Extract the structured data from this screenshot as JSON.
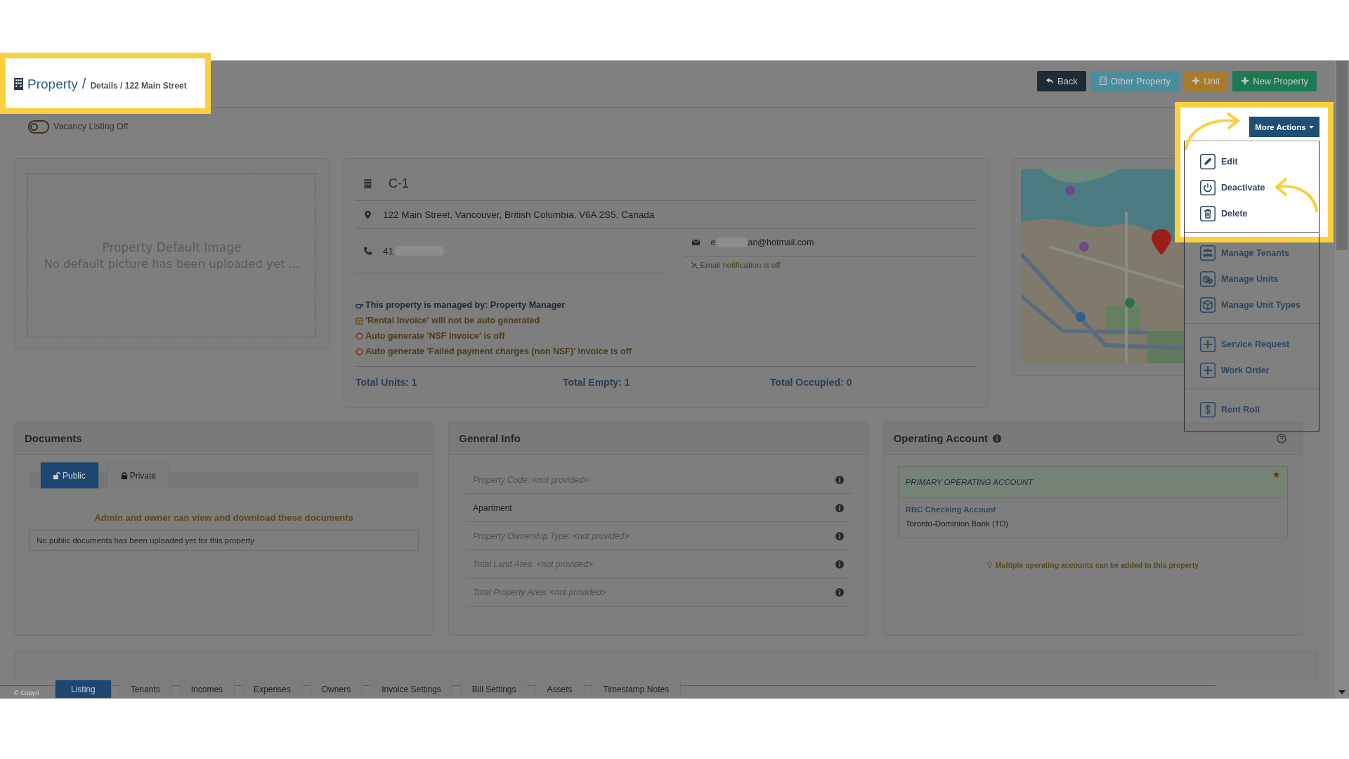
{
  "breadcrumb": {
    "title": "Property",
    "separator": "/",
    "path": "Details / 122 Main Street"
  },
  "header_buttons": [
    {
      "label": "Back",
      "kind": "back"
    },
    {
      "label": "Other Property",
      "kind": "other"
    },
    {
      "label": "Unit",
      "kind": "unit"
    },
    {
      "label": "New Property",
      "kind": "new"
    }
  ],
  "vacancy_listing": {
    "label": "Vacancy Listing Off",
    "on": false
  },
  "default_image": {
    "title": "Property Default Image",
    "message": "No default picture has been uploaded yet ..."
  },
  "property": {
    "name": "C-1",
    "address": "122 Main Street, Vancouver, British Columbia, V6A 2S5, Canada",
    "phone": "41",
    "email_start": "e",
    "email_end": "an@hotmail.com",
    "email_notification": "Email notification is off",
    "notes": [
      {
        "kind": "managed",
        "text": "This property is managed by: Property Manager"
      },
      {
        "kind": "calendar",
        "text": "'Rental Invoice' will not be auto generated"
      },
      {
        "kind": "off",
        "text": "Auto generate 'NSF Invoice' is off"
      },
      {
        "kind": "off",
        "text": "Auto generate 'Failed payment charges (non NSF)' invoice is off"
      }
    ],
    "totals": [
      "Total Units: 1",
      "Total Empty: 1",
      "Total Occupied: 0"
    ]
  },
  "more_actions": {
    "label": "More Actions",
    "groups": [
      [
        {
          "label": "Edit",
          "kind": "edit"
        },
        {
          "label": "Deactivate",
          "kind": "deactivate"
        },
        {
          "label": "Delete",
          "kind": "delete"
        }
      ],
      [
        {
          "label": "Manage Tenants",
          "kind": "tenants"
        },
        {
          "label": "Manage Units",
          "kind": "units"
        },
        {
          "label": "Manage Unit Types",
          "kind": "unit_types"
        }
      ],
      [
        {
          "label": "Service Request",
          "kind": "plus"
        },
        {
          "label": "Work Order",
          "kind": "plus"
        }
      ],
      [
        {
          "label": "Rent Roll",
          "kind": "dollar"
        }
      ]
    ]
  },
  "documents": {
    "title": "Documents",
    "tabs": [
      {
        "label": "Public",
        "kind": "public",
        "selected": true
      },
      {
        "label": "Private",
        "kind": "private",
        "selected": false
      }
    ],
    "notice": "Admin and owner can view and download these documents",
    "empty_message": "No public documents has been uploaded yet for this property"
  },
  "general_info": {
    "title": "General Info",
    "rows": [
      {
        "text": "Property Code: <not provided>",
        "provided": false
      },
      {
        "text": "Apartment",
        "provided": true
      },
      {
        "text": "Property Ownership Type: <not provided>",
        "provided": false
      },
      {
        "text": "Total Land Area: <not provided>",
        "provided": false
      },
      {
        "text": "Total Property Area: <not provided>",
        "provided": false
      }
    ]
  },
  "operating_account": {
    "title": "Operating Account",
    "account_header": "PRIMARY OPERATING ACCOUNT",
    "primary": true,
    "account_name": "RBC Checking Account",
    "bank": "Toronto-Dominion Bank (TD)",
    "hint": "Multiple operating accounts can be added to this property"
  },
  "copyright": "© Copyri",
  "bottom_tabs": [
    {
      "label": "Listing",
      "selected": true
    },
    {
      "label": "Tenants",
      "selected": false
    },
    {
      "label": "Incomes",
      "selected": false
    },
    {
      "label": "Expenses",
      "selected": false
    },
    {
      "label": "Owners",
      "selected": false
    },
    {
      "label": "Invoice Settings",
      "selected": false
    },
    {
      "label": "Bill Settings",
      "selected": false
    },
    {
      "label": "Assets",
      "selected": false
    },
    {
      "label": "Timestamp Notes",
      "selected": false
    }
  ]
}
